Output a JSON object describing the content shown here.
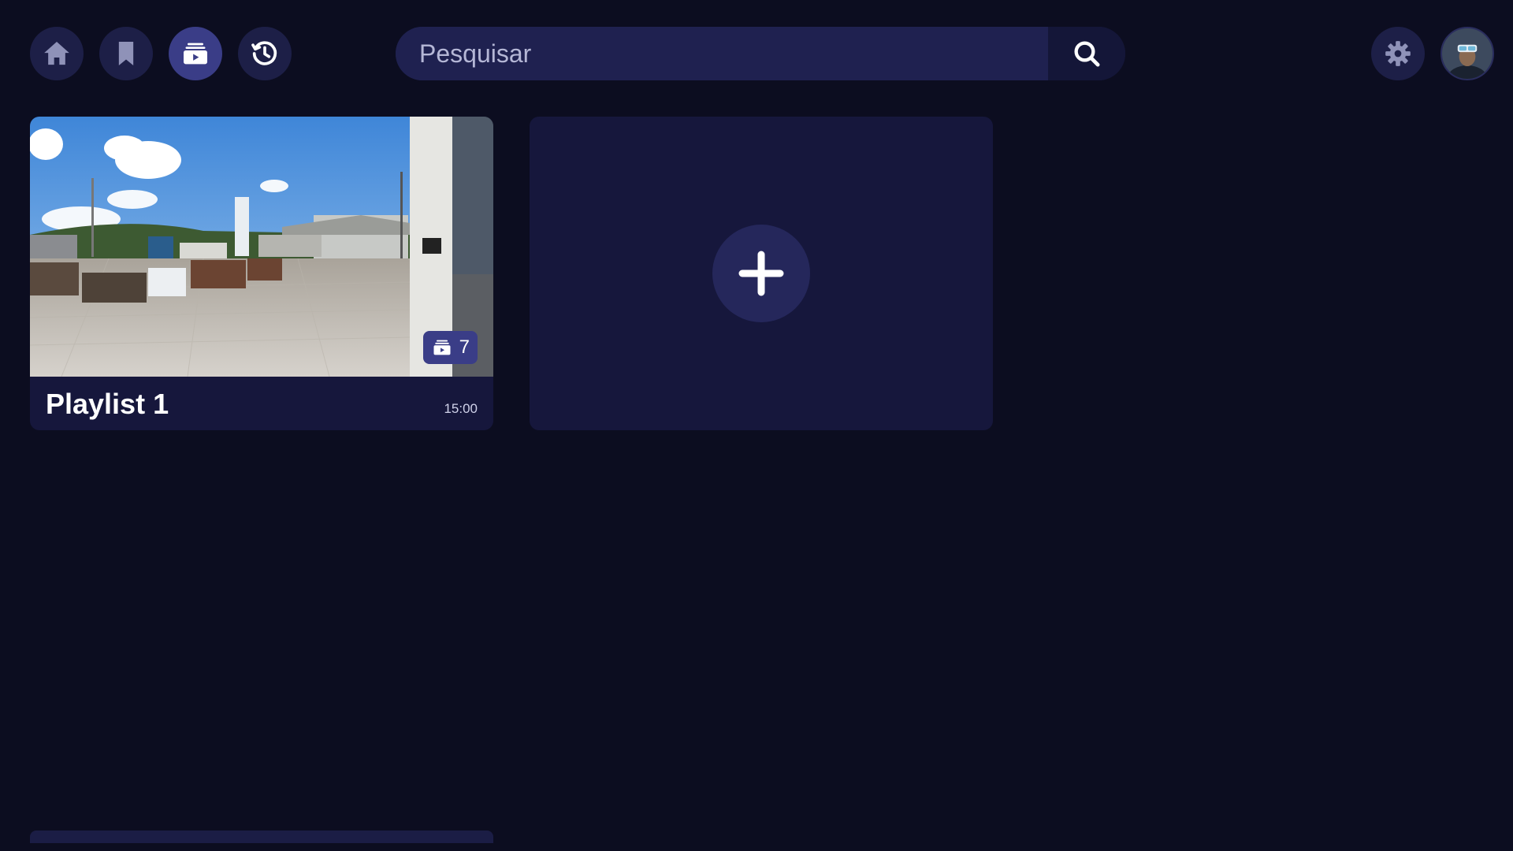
{
  "nav": {
    "items": [
      {
        "icon": "home-icon",
        "active": false
      },
      {
        "icon": "bookmark-icon",
        "active": false
      },
      {
        "icon": "playlist-icon",
        "active": true
      },
      {
        "icon": "history-icon",
        "active": false
      }
    ]
  },
  "search": {
    "placeholder": "Pesquisar",
    "value": ""
  },
  "header_right": {
    "settings_icon": "gear-icon",
    "avatar_icon": "user-avatar-vr"
  },
  "playlists": [
    {
      "title": "Playlist 1",
      "duration": "15:00",
      "item_count": "7"
    }
  ],
  "add_card": {
    "icon": "plus-icon"
  },
  "colors": {
    "background": "#0c0d20",
    "surface": "#16173c",
    "button": "#1d1f47",
    "active": "#3a3d87",
    "text": "#ffffff"
  }
}
